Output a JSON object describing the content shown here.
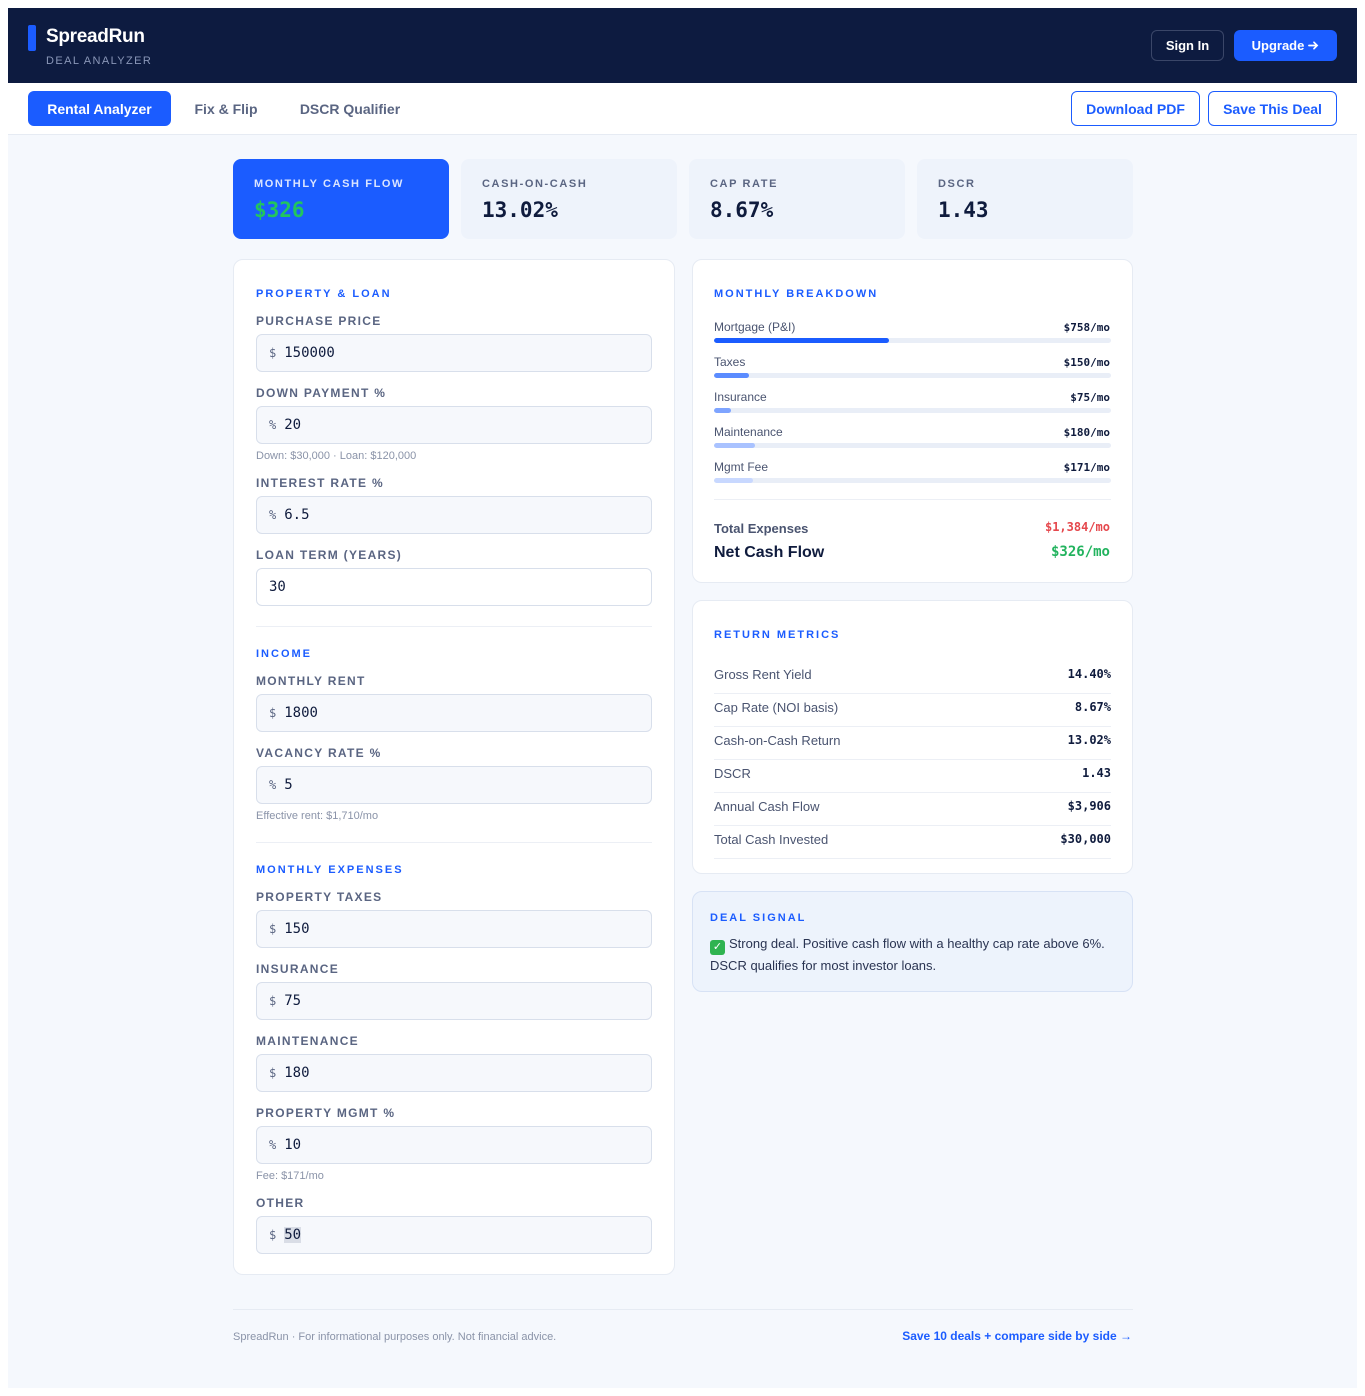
{
  "brand": {
    "name": "SpreadRun",
    "subtitle": "DEAL ANALYZER"
  },
  "header": {
    "signin_label": "Sign In",
    "upgrade_label": "Upgrade",
    "upgrade_icon": "arrow-right-icon"
  },
  "tabs": [
    {
      "label": "Rental Analyzer",
      "active": true
    },
    {
      "label": "Fix & Flip",
      "active": false
    },
    {
      "label": "DSCR Qualifier",
      "active": false
    }
  ],
  "actions": {
    "download_label": "Download PDF",
    "save_label": "Save This Deal"
  },
  "kpis": [
    {
      "label": "MONTHLY CASH FLOW",
      "value": "$326"
    },
    {
      "label": "CASH-ON-CASH",
      "value": "13.02%"
    },
    {
      "label": "CAP RATE",
      "value": "8.67%"
    },
    {
      "label": "DSCR",
      "value": "1.43"
    }
  ],
  "property": {
    "title": "PROPERTY & LOAN",
    "purchase_price": {
      "label": "PURCHASE PRICE",
      "prefix": "$",
      "value": "150000"
    },
    "down_payment": {
      "label": "DOWN PAYMENT %",
      "prefix": "%",
      "value": "20",
      "hint": "Down: $30,000 · Loan: $120,000"
    },
    "interest_rate": {
      "label": "INTEREST RATE %",
      "prefix": "%",
      "value": "6.5"
    },
    "loan_term": {
      "label": "LOAN TERM (YEARS)",
      "value": "30"
    }
  },
  "income": {
    "title": "INCOME",
    "monthly_rent": {
      "label": "MONTHLY RENT",
      "prefix": "$",
      "value": "1800"
    },
    "vacancy_rate": {
      "label": "VACANCY RATE %",
      "prefix": "%",
      "value": "5",
      "hint": "Effective rent: $1,710/mo"
    }
  },
  "expenses": {
    "title": "MONTHLY EXPENSES",
    "property_taxes": {
      "label": "PROPERTY TAXES",
      "prefix": "$",
      "value": "150"
    },
    "insurance": {
      "label": "INSURANCE",
      "prefix": "$",
      "value": "75"
    },
    "maintenance": {
      "label": "MAINTENANCE",
      "prefix": "$",
      "value": "180"
    },
    "property_mgmt": {
      "label": "PROPERTY MGMT %",
      "prefix": "%",
      "value": "10",
      "hint": "Fee: $171/mo"
    },
    "other": {
      "label": "OTHER",
      "prefix": "$",
      "value": "50"
    }
  },
  "breakdown": {
    "title": "MONTHLY BREAKDOWN",
    "items": [
      {
        "label": "Mortgage (P&I)",
        "value": "$758/mo",
        "share": 0.44,
        "color": "#1b5cff"
      },
      {
        "label": "Taxes",
        "value": "$150/mo",
        "share": 0.087,
        "color": "#5b8cff"
      },
      {
        "label": "Insurance",
        "value": "$75/mo",
        "share": 0.044,
        "color": "#7ea4ff"
      },
      {
        "label": "Maintenance",
        "value": "$180/mo",
        "share": 0.104,
        "color": "#a9c2ff"
      },
      {
        "label": "Mgmt Fee",
        "value": "$171/mo",
        "share": 0.099,
        "color": "#c8d8ff"
      }
    ],
    "total_label": "Total Expenses",
    "total_value": "$1,384/mo",
    "net_label": "Net Cash Flow",
    "net_value": "$326/mo"
  },
  "returns": {
    "title": "RETURN METRICS",
    "rows": [
      {
        "label": "Gross Rent Yield",
        "value": "14.40%"
      },
      {
        "label": "Cap Rate (NOI basis)",
        "value": "8.67%"
      },
      {
        "label": "Cash-on-Cash Return",
        "value": "13.02%"
      },
      {
        "label": "DSCR",
        "value": "1.43"
      },
      {
        "label": "Annual Cash Flow",
        "value": "$3,906"
      },
      {
        "label": "Total Cash Invested",
        "value": "$30,000"
      }
    ]
  },
  "signal": {
    "title": "DEAL SIGNAL",
    "icon": "check-icon",
    "text": "Strong deal. Positive cash flow with a healthy cap rate above 6%. DSCR qualifies for most investor loans."
  },
  "footer": {
    "disclaimer": "SpreadRun · For informational purposes only. Not financial advice.",
    "cta": "Save 10 deals + compare side by side →"
  },
  "colors": {
    "primary": "#1b5cff",
    "navy": "#0d1b40",
    "positive": "#22c55e",
    "negative": "#e5484d"
  }
}
